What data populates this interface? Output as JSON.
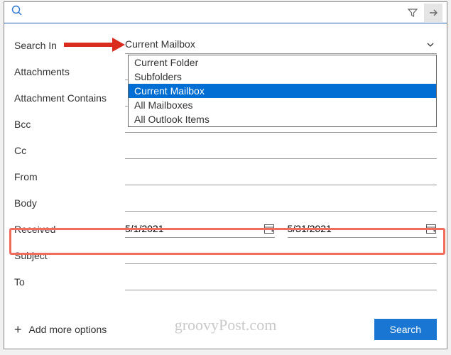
{
  "form": {
    "searchIn": {
      "label": "Search In",
      "value": "Current Mailbox"
    },
    "attachments": {
      "label": "Attachments"
    },
    "attachmentContains": {
      "label": "Attachment Contains"
    },
    "bcc": {
      "label": "Bcc"
    },
    "cc": {
      "label": "Cc"
    },
    "from": {
      "label": "From"
    },
    "body": {
      "label": "Body"
    },
    "received": {
      "label": "Received",
      "dateFrom": "5/1/2021",
      "dateTo": "5/31/2021"
    },
    "subject": {
      "label": "Subject"
    },
    "to": {
      "label": "To"
    }
  },
  "dropdown": {
    "items": [
      {
        "label": "Current Folder"
      },
      {
        "label": "Subfolders"
      },
      {
        "label": "Current Mailbox"
      },
      {
        "label": "All Mailboxes"
      },
      {
        "label": "All Outlook Items"
      }
    ]
  },
  "actions": {
    "addMore": "Add more options",
    "search": "Search"
  },
  "watermark": "groovyPost.com"
}
